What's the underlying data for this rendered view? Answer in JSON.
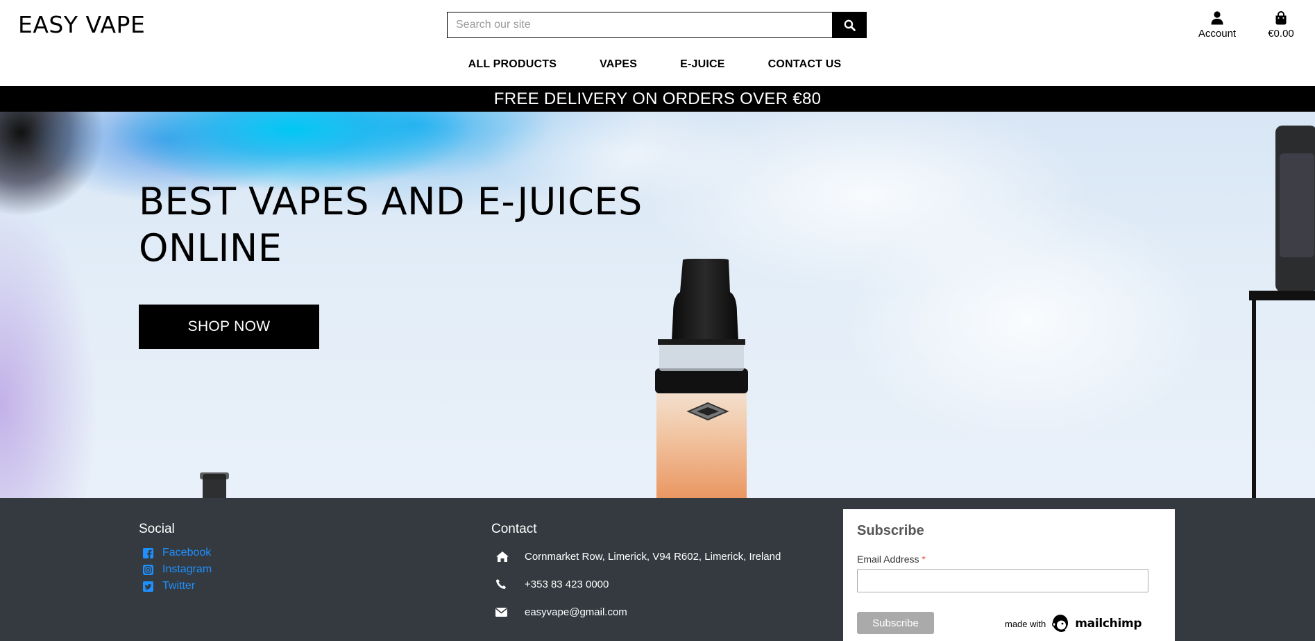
{
  "header": {
    "logo": "EASY VAPE",
    "search_placeholder": "Search our site",
    "account_label": "Account",
    "bag_total": "€0.00"
  },
  "nav": {
    "items": [
      "ALL PRODUCTS",
      "VAPES",
      "E-JUICE",
      "CONTACT US"
    ]
  },
  "banner": {
    "text": "FREE DELIVERY ON ORDERS OVER €80"
  },
  "hero": {
    "title": "BEST VAPES AND E-JUICES ONLINE",
    "cta_label": "SHOP NOW"
  },
  "footer": {
    "social": {
      "title": "Social",
      "links": [
        {
          "label": "Facebook",
          "icon": "facebook-icon"
        },
        {
          "label": "Instagram",
          "icon": "instagram-icon"
        },
        {
          "label": "Twitter",
          "icon": "twitter-icon"
        }
      ]
    },
    "contact": {
      "title": "Contact",
      "address": "Cornmarket Row, Limerick, V94 R602, Limerick, Ireland",
      "phone": "+353 83 423 0000",
      "email": "easyvape@gmail.com"
    },
    "subscribe": {
      "title": "Subscribe",
      "email_label": "Email Address",
      "required_mark": "*",
      "button_label": "Subscribe",
      "made_with": "made with",
      "brand": "mailchimp"
    }
  },
  "colors": {
    "footer_bg": "#343a40",
    "link": "#1e90ff",
    "black": "#000000"
  }
}
